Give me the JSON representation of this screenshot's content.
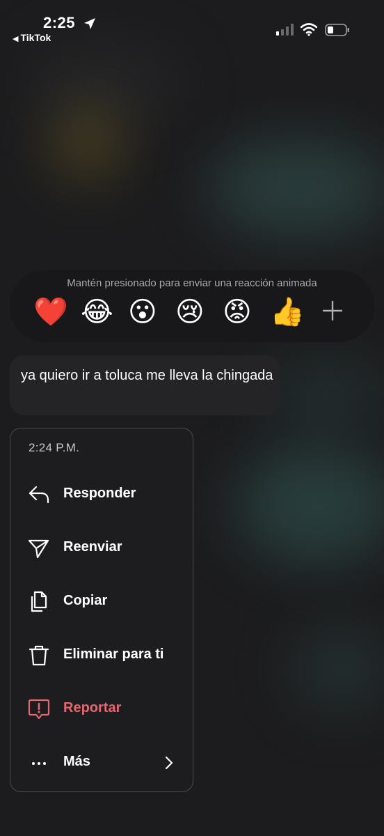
{
  "status_bar": {
    "time": "2:25",
    "back_app": "TikTok",
    "back_arrow": "◀"
  },
  "reactions": {
    "hint": "Mantén presionado para enviar una reacción animada",
    "emojis": [
      "❤️",
      "😂",
      "😮",
      "😢",
      "😡",
      "👍"
    ],
    "more_icon": "plus-icon"
  },
  "message": {
    "text": "ya quiero ir a toluca me lleva la chingada"
  },
  "menu": {
    "time": "2:24 P.M.",
    "items": [
      {
        "label": "Responder",
        "icon": "reply-icon"
      },
      {
        "label": "Reenviar",
        "icon": "send-icon"
      },
      {
        "label": "Copiar",
        "icon": "copy-icon"
      },
      {
        "label": "Eliminar para ti",
        "icon": "trash-icon"
      },
      {
        "label": "Reportar",
        "icon": "report-icon"
      },
      {
        "label": "Más",
        "icon": "more-icon"
      }
    ]
  },
  "colors": {
    "background": "#1c1c1e",
    "menu_background": "#1e1e20",
    "report": "#e9656f",
    "bubble": "#242426"
  }
}
